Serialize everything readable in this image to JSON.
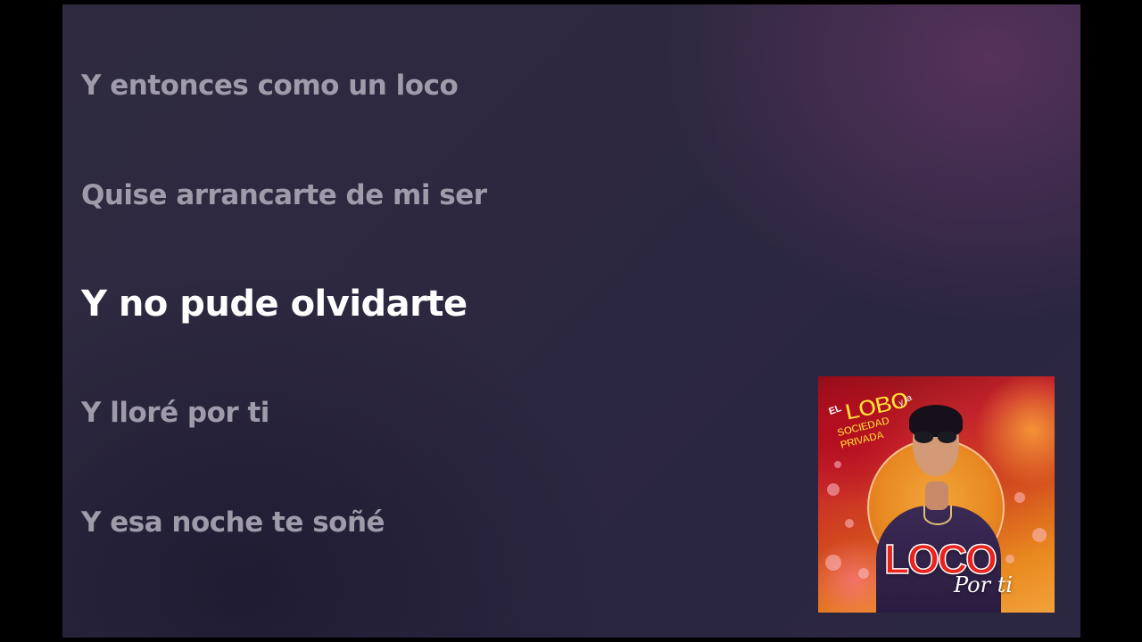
{
  "lyrics": {
    "lines": [
      "Y entonces como un loco",
      "Quise arrancarte de mi ser",
      "Y no pude olvidarte",
      "Y lloré por ti",
      "Y esa noche te soñé"
    ],
    "active_index": 2
  },
  "album_cover": {
    "band_logo": {
      "prefix": "EL",
      "name": "LOBO",
      "connector": "y la",
      "subname": "SOCIEDAD PRIVADA"
    },
    "title": "LOCO",
    "subtitle": "Por ti"
  },
  "colors": {
    "background": "#2d2840",
    "active_lyric": "#ffffff",
    "inactive_lyric": "#9f9baa",
    "cover_title": "#e8231d"
  }
}
